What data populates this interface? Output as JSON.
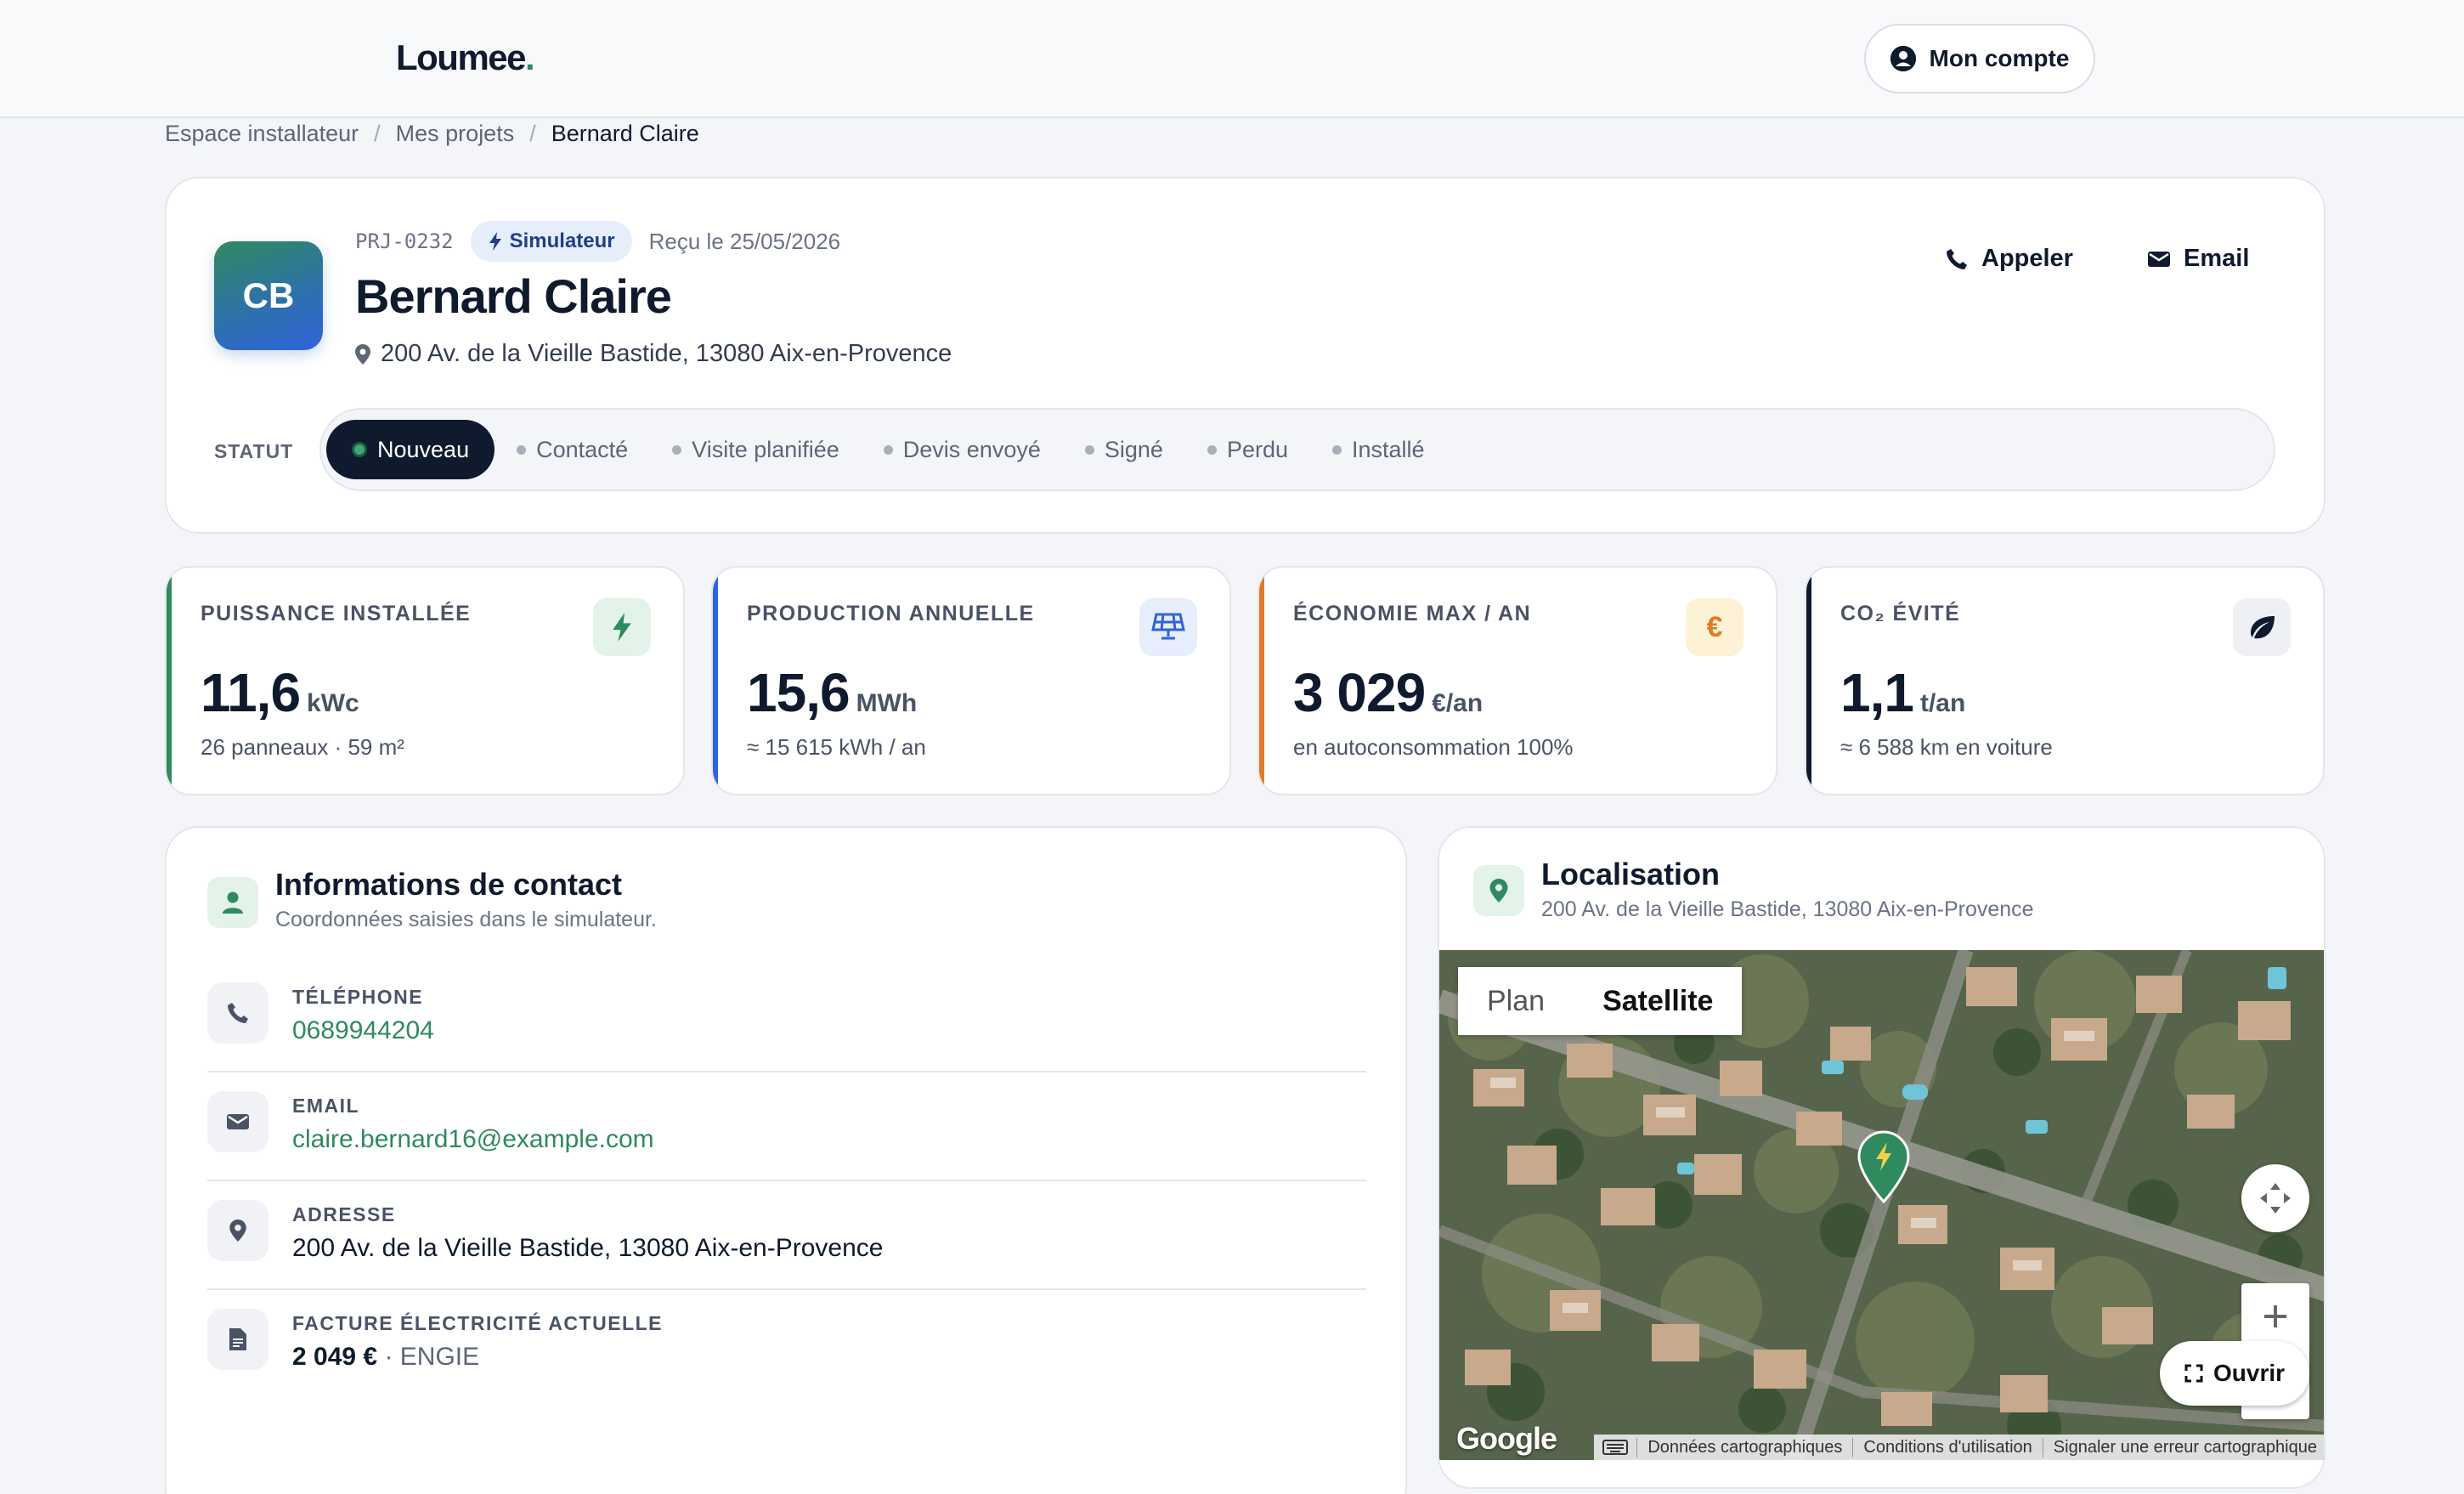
{
  "brand": {
    "name": "Loumee",
    "dot": "."
  },
  "header": {
    "account_label": "Mon compte"
  },
  "breadcrumb": [
    "Espace installateur",
    "Mes projets",
    "Bernard Claire"
  ],
  "project": {
    "initials": "CB",
    "id": "PRJ-0232",
    "source_badge": "Simulateur",
    "received": "Reçu le 25/05/2026",
    "name": "Bernard Claire",
    "address": "200 Av. de la Vieille Bastide, 13080 Aix-en-Provence",
    "actions": {
      "call": "Appeler",
      "email": "Email"
    },
    "status_label": "STATUT",
    "statuses": [
      "Nouveau",
      "Contacté",
      "Visite planifiée",
      "Devis envoyé",
      "Signé",
      "Perdu",
      "Installé"
    ],
    "active_status": "Nouveau"
  },
  "stats": [
    {
      "label": "PUISSANCE INSTALLÉE",
      "value": "11,6",
      "unit": "kWc",
      "sub": "26 panneaux · 59 m²",
      "accent": "#2f8a5e",
      "icon": "bolt-icon"
    },
    {
      "label": "PRODUCTION ANNUELLE",
      "value": "15,6",
      "unit": "MWh",
      "sub": "≈ 15 615 kWh / an",
      "accent": "#2f64d8",
      "icon": "solar-panel-icon"
    },
    {
      "label": "ÉCONOMIE MAX / AN",
      "value": "3 029",
      "unit": "€/an",
      "sub": "en autoconsommation 100%",
      "accent": "#e07b22",
      "icon": "euro-icon"
    },
    {
      "label": "CO₂ ÉVITÉ",
      "value": "1,1",
      "unit": "t/an",
      "sub": "≈ 6 588 km en voiture",
      "accent": "#0f1a2e",
      "icon": "leaf-icon"
    }
  ],
  "contact": {
    "title": "Informations de contact",
    "subtitle": "Coordonnées saisies dans le simulateur.",
    "phone_label": "TÉLÉPHONE",
    "phone": "0689944204",
    "email_label": "EMAIL",
    "email": "claire.bernard16@example.com",
    "address_label": "ADRESSE",
    "address": "200 Av. de la Vieille Bastide, 13080 Aix-en-Provence",
    "bill_label": "FACTURE ÉLECTRICITÉ ACTUELLE",
    "bill_amount": "2 049 €",
    "bill_provider": "· ENGIE"
  },
  "location": {
    "title": "Localisation",
    "subtitle": "200 Av. de la Vieille Bastide, 13080 Aix-en-Provence",
    "map_type_plan": "Plan",
    "map_type_satellite": "Satellite",
    "open_label": "Ouvrir",
    "google": "Google",
    "attribution": [
      "Données cartographiques",
      "Conditions d'utilisation",
      "Signaler une erreur cartographique"
    ]
  },
  "colors": {
    "primary": "#0f1a2e",
    "green": "#2f8a5e",
    "blue": "#2f64d8",
    "orange": "#e07b22"
  }
}
